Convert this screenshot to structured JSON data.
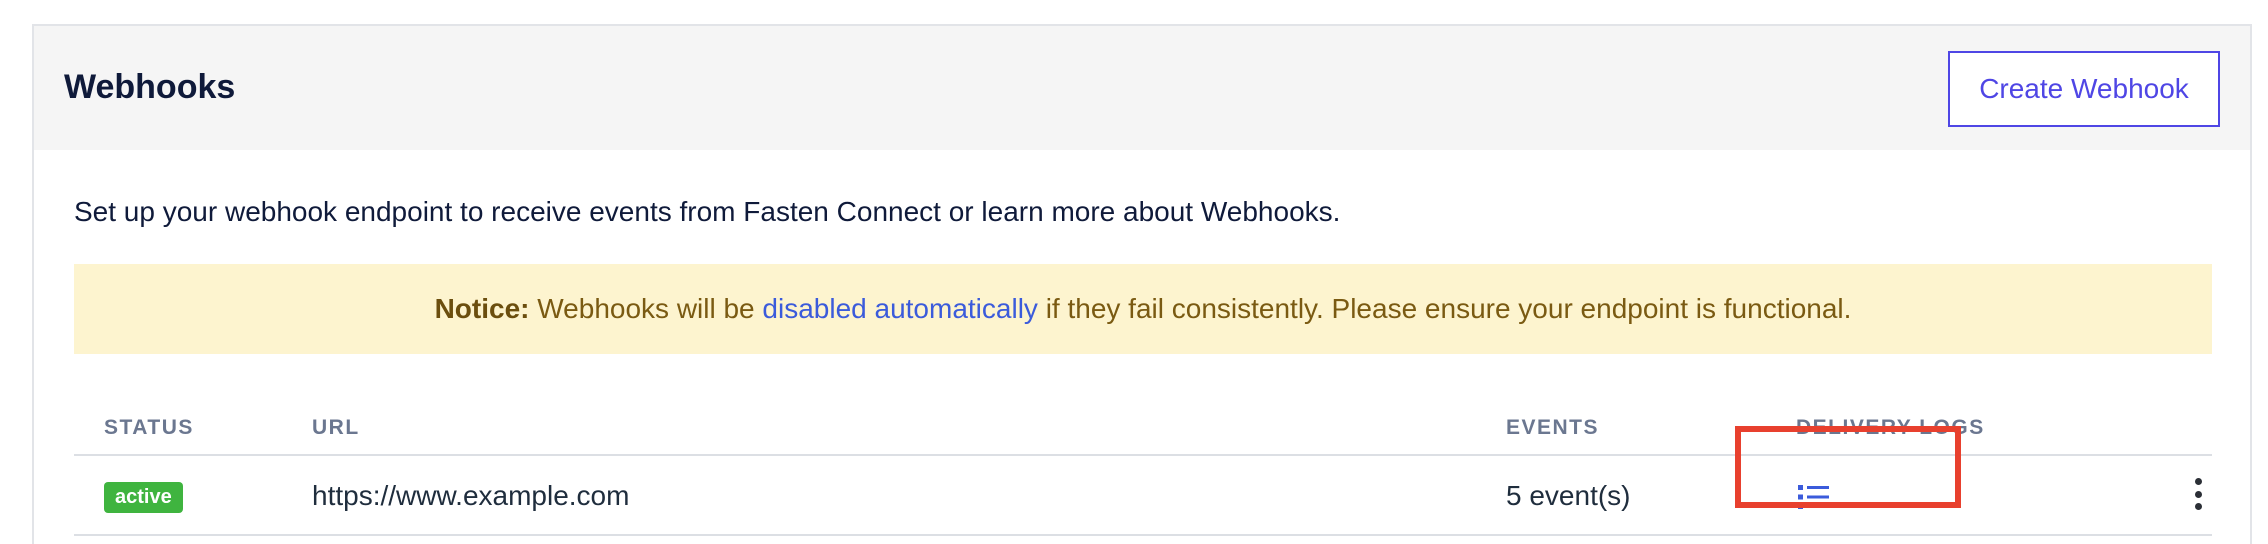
{
  "header": {
    "title": "Webhooks",
    "create_button": "Create Webhook"
  },
  "intro_text": "Set up your webhook endpoint to receive events from Fasten Connect or learn more about Webhooks.",
  "notice": {
    "label": "Notice:",
    "before_link": " Webhooks will be ",
    "link_text": "disabled automatically",
    "after_link": " if they fail consistently. Please ensure your endpoint is functional."
  },
  "table": {
    "columns": [
      "STATUS",
      "URL",
      "EVENTS",
      "DELIVERY LOGS"
    ],
    "rows": [
      {
        "status": "active",
        "url": "https://www.example.com",
        "events": "5 event(s)"
      }
    ]
  },
  "icons": {
    "delivery_logs": "list-icon",
    "actions": "more-vertical-icon"
  },
  "colors": {
    "accent": "#4f46e5",
    "link": "#3b5bdb",
    "status_active": "#3fb43f",
    "notice_bg": "#fdf4cf",
    "highlight": "#e8402e"
  }
}
